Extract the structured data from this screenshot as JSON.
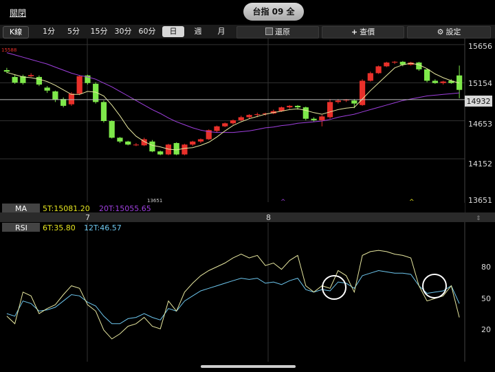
{
  "topbar": {
    "close_label": "關閉",
    "title": "台指 09 全"
  },
  "toolbar": {
    "kline_label": "K線",
    "timeframes": [
      "1分",
      "5分",
      "15分",
      "30分",
      "60分",
      "日",
      "週",
      "月"
    ],
    "selected_timeframe": "日",
    "restore_label": "還原",
    "lookup_label": "查價",
    "settings_label": "設定"
  },
  "price_chart": {
    "y_ticks": [
      "15656",
      "15154",
      "14653",
      "14152",
      "13651"
    ],
    "current_price": "14932",
    "high_marker": "15588",
    "low_marker": "13651",
    "colors": {
      "up": "#e8302a",
      "down": "#7ee84a",
      "ma5": "#e8e8a0",
      "ma20": "#a040e0",
      "bg": "#000000"
    }
  },
  "ma_panel": {
    "label": "MA",
    "ma5": "5T:15081.20",
    "ma20": "20T:15055.65"
  },
  "x_axis": {
    "labels": [
      "7",
      "8"
    ]
  },
  "rsi_panel": {
    "label": "RSI",
    "rsi6": "6T:35.80",
    "rsi12": "12T:46.57",
    "y_ticks": [
      "80",
      "50",
      "20"
    ]
  },
  "chart_data": {
    "type": "candlestick",
    "candles": [
      [
        15320,
        15300,
        15350,
        15280
      ],
      [
        15230,
        15155,
        15260,
        15140
      ],
      [
        15240,
        15150,
        15260,
        15130
      ],
      [
        15240,
        15255,
        15280,
        15230
      ],
      [
        15230,
        15130,
        15250,
        15110
      ],
      [
        15090,
        15050,
        15110,
        15020
      ],
      [
        15040,
        14930,
        15050,
        14900
      ],
      [
        14940,
        14850,
        14960,
        14830
      ],
      [
        14870,
        15010,
        15030,
        14850
      ],
      [
        15010,
        15240,
        15250,
        14990
      ],
      [
        15250,
        15150,
        15260,
        15130
      ],
      [
        15140,
        14900,
        15160,
        14880
      ],
      [
        14900,
        14650,
        14920,
        14630
      ],
      [
        14650,
        14430,
        14660,
        14420
      ],
      [
        14430,
        14380,
        14440,
        14360
      ],
      [
        14380,
        14340,
        14390,
        14330
      ],
      [
        14330,
        14340,
        14360,
        14320
      ],
      [
        14330,
        14410,
        14430,
        14320
      ],
      [
        14380,
        14250,
        14400,
        14240
      ],
      [
        14250,
        14210,
        14260,
        14200
      ],
      [
        14210,
        14340,
        14350,
        14200
      ],
      [
        14360,
        14210,
        14370,
        14200
      ],
      [
        14210,
        14340,
        14350,
        14200
      ],
      [
        14340,
        14380,
        14390,
        14320
      ],
      [
        14380,
        14410,
        14420,
        14360
      ],
      [
        14410,
        14530,
        14540,
        14400
      ],
      [
        14520,
        14580,
        14590,
        14500
      ],
      [
        14580,
        14620,
        14630,
        14570
      ],
      [
        14620,
        14660,
        14670,
        14600
      ],
      [
        14660,
        14700,
        14720,
        14650
      ],
      [
        14700,
        14730,
        14740,
        14680
      ],
      [
        14730,
        14740,
        14760,
        14700
      ],
      [
        14740,
        14750,
        14760,
        14720
      ],
      [
        14750,
        14780,
        14800,
        14740
      ],
      [
        14780,
        14830,
        14840,
        14770
      ],
      [
        14830,
        14850,
        14860,
        14810
      ],
      [
        14850,
        14830,
        14860,
        14800
      ],
      [
        14830,
        14680,
        14840,
        14660
      ],
      [
        14680,
        14660,
        14700,
        14640
      ],
      [
        14660,
        14710,
        14730,
        14580
      ],
      [
        14700,
        14900,
        14940,
        14680
      ],
      [
        14900,
        14920,
        14940,
        14880
      ],
      [
        14920,
        14930,
        14940,
        14900
      ],
      [
        14920,
        14880,
        14940,
        14820
      ],
      [
        14860,
        15180,
        15200,
        14850
      ],
      [
        15180,
        15280,
        15300,
        15170
      ],
      [
        15280,
        15370,
        15380,
        15270
      ],
      [
        15370,
        15420,
        15430,
        15360
      ],
      [
        15420,
        15430,
        15440,
        15400
      ],
      [
        15430,
        15390,
        15440,
        15370
      ],
      [
        15390,
        15420,
        15430,
        15380
      ],
      [
        15420,
        15330,
        15430,
        15310
      ],
      [
        15330,
        15180,
        15340,
        15160
      ],
      [
        15180,
        15150,
        15200,
        15140
      ],
      [
        15150,
        15170,
        15180,
        15130
      ],
      [
        15180,
        15150,
        15200,
        15140
      ],
      [
        15250,
        15060,
        15380,
        14950
      ]
    ],
    "price_min": 13600,
    "price_max": 15700,
    "current": 14932,
    "ma5": [
      15290,
      15260,
      15230,
      15220,
      15200,
      15170,
      15120,
      15060,
      15000,
      15000,
      15040,
      15030,
      14980,
      14860,
      14720,
      14560,
      14450,
      14380,
      14330,
      14310,
      14280,
      14270,
      14290,
      14300,
      14330,
      14370,
      14440,
      14520,
      14590,
      14640,
      14680,
      14710,
      14740,
      14760,
      14780,
      14800,
      14810,
      14790,
      14760,
      14740,
      14770,
      14800,
      14820,
      14830,
      14940,
      15050,
      15150,
      15250,
      15350,
      15390,
      15410,
      15390,
      15340,
      15270,
      15220,
      15180,
      15150
    ],
    "ma20": [
      15550,
      15520,
      15490,
      15460,
      15430,
      15400,
      15360,
      15320,
      15280,
      15250,
      15230,
      15200,
      15150,
      15100,
      15040,
      14980,
      14920,
      14860,
      14800,
      14750,
      14690,
      14640,
      14600,
      14560,
      14530,
      14510,
      14500,
      14500,
      14500,
      14510,
      14520,
      14540,
      14560,
      14570,
      14590,
      14600,
      14620,
      14630,
      14640,
      14650,
      14670,
      14700,
      14720,
      14740,
      14770,
      14800,
      14830,
      14860,
      14890,
      14920,
      14940,
      14960,
      14980,
      14990,
      15000,
      15010,
      15020
    ],
    "rsi6": [
      36,
      30,
      55,
      52,
      38,
      42,
      45,
      53,
      60,
      58,
      45,
      40,
      25,
      18,
      22,
      28,
      30,
      35,
      28,
      26,
      48,
      40,
      55,
      62,
      68,
      72,
      75,
      78,
      82,
      85,
      82,
      84,
      76,
      78,
      73,
      80,
      84,
      60,
      55,
      60,
      58,
      72,
      68,
      55,
      84,
      87,
      88,
      87,
      85,
      84,
      82,
      60,
      48,
      50,
      52,
      60,
      35
    ],
    "rsi12": [
      38,
      36,
      48,
      46,
      40,
      41,
      43,
      48,
      53,
      52,
      47,
      44,
      36,
      30,
      30,
      34,
      35,
      38,
      35,
      33,
      42,
      40,
      48,
      52,
      56,
      58,
      60,
      62,
      64,
      66,
      65,
      66,
      62,
      63,
      61,
      64,
      66,
      57,
      55,
      57,
      56,
      63,
      62,
      58,
      68,
      70,
      72,
      71,
      70,
      70,
      69,
      60,
      54,
      55,
      56,
      60,
      46
    ]
  }
}
